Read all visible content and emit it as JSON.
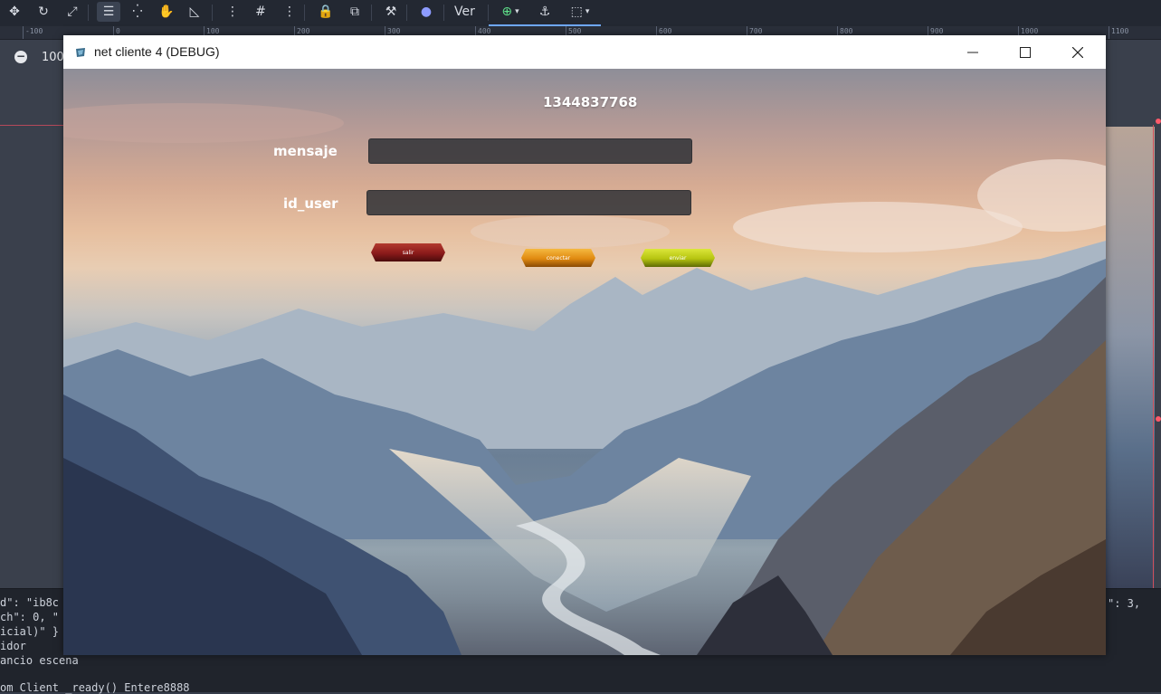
{
  "editor": {
    "toolbar": {
      "icons": [
        "move-icon",
        "rotate-icon",
        "scale-icon",
        "select-icon",
        "smart-select-icon",
        "pan-hand-icon",
        "ruler-icon",
        "pivot-icon",
        "grid-snap-icon",
        "more-options-icon",
        "lock-icon",
        "group-icon",
        "bone-icon",
        "camera-icon",
        "add-node-icon",
        "anchor-icon",
        "layout-icon"
      ],
      "view_label": "Ver"
    },
    "ruler_labels": [
      "-100",
      "0",
      "100",
      "200",
      "300",
      "400",
      "500",
      "600",
      "700",
      "800",
      "900",
      "1000",
      "1100"
    ],
    "zoom_level": "100",
    "console": {
      "lines": [
        "d\": \"ib8c",
        "ch\": 0, \"",
        "icial)\" }",
        "idor",
        "ancio escena",
        "",
        "om Client _ready() Entere8888"
      ],
      "right_text": "\": 3,"
    }
  },
  "window": {
    "title": "net cliente 4 (DEBUG)",
    "controls": {
      "minimize": "minimize-icon",
      "maximize": "maximize-icon",
      "close": "close-icon"
    }
  },
  "game": {
    "counter": "1344837768",
    "mensaje": {
      "label": "mensaje",
      "value": ""
    },
    "id_user": {
      "label": "id_user",
      "value": ""
    },
    "buttons": {
      "salir": {
        "label": "salir",
        "color": "#8b1a1a"
      },
      "conectar": {
        "label": "conectar",
        "color": "#e08a10"
      },
      "enviar": {
        "label": "enviar",
        "color": "#b6c410"
      }
    }
  }
}
